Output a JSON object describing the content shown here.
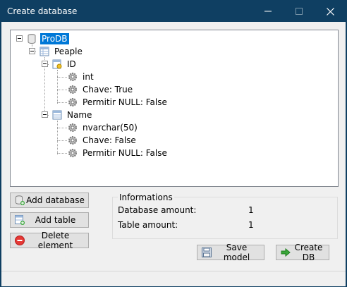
{
  "window": {
    "title": "Create database"
  },
  "tree": {
    "root": {
      "label": "ProDB",
      "selected": true
    },
    "table": {
      "label": "Peaple"
    },
    "columns": [
      {
        "label": "ID",
        "props": [
          "int",
          "Chave: True",
          "Permitir NULL: False"
        ]
      },
      {
        "label": "Name",
        "props": [
          "nvarchar(50)",
          "Chave: False",
          "Permitir NULL: False"
        ]
      }
    ]
  },
  "buttons": {
    "add_database": "Add database",
    "add_table": "Add table",
    "delete_element": "Delete element",
    "save_model": "Save model",
    "create_db": "Create DB"
  },
  "info": {
    "legend": "Informations",
    "database_amount_label": "Database amount:",
    "database_amount_value": "1",
    "table_amount_label": "Table amount:",
    "table_amount_value": "1"
  },
  "colors": {
    "titlebar": "#0f3f62",
    "selection": "#0078d7"
  },
  "icons": [
    "database-icon",
    "table-icon",
    "column-key-icon",
    "gear-icon",
    "delete-icon",
    "save-icon",
    "arrow-right-icon"
  ]
}
